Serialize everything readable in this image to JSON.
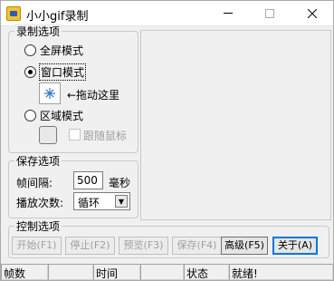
{
  "window": {
    "title": "小小gif录制",
    "min_glyph": "—",
    "max_glyph": "☐",
    "close_glyph": "✕"
  },
  "record_options": {
    "title": "录制选项",
    "fullscreen": "全屏模式",
    "window_mode": "窗口模式",
    "drag_here": "←拖动这里",
    "region_mode": "区域模式",
    "follow_mouse": "跟随鼠标"
  },
  "save_options": {
    "title": "保存选项",
    "frame_interval_label": "帧间隔:",
    "frame_interval_value": "500",
    "unit": "毫秒",
    "play_count_label": "播放次数:",
    "play_count_value": "循环"
  },
  "control_options": {
    "title": "控制选项",
    "start": "开始(F1)",
    "stop": "停止(F2)",
    "preview": "预览(F3)",
    "save": "保存(F4)",
    "advanced": "高级(F5)",
    "about": "关于(A)"
  },
  "status_bar": {
    "frames": "帧数",
    "time": "时间",
    "status": "状态",
    "ready": "就绪!"
  },
  "icons": {
    "app": "gif-recorder-icon",
    "drag_target": "crosshair-snowflake-icon"
  }
}
